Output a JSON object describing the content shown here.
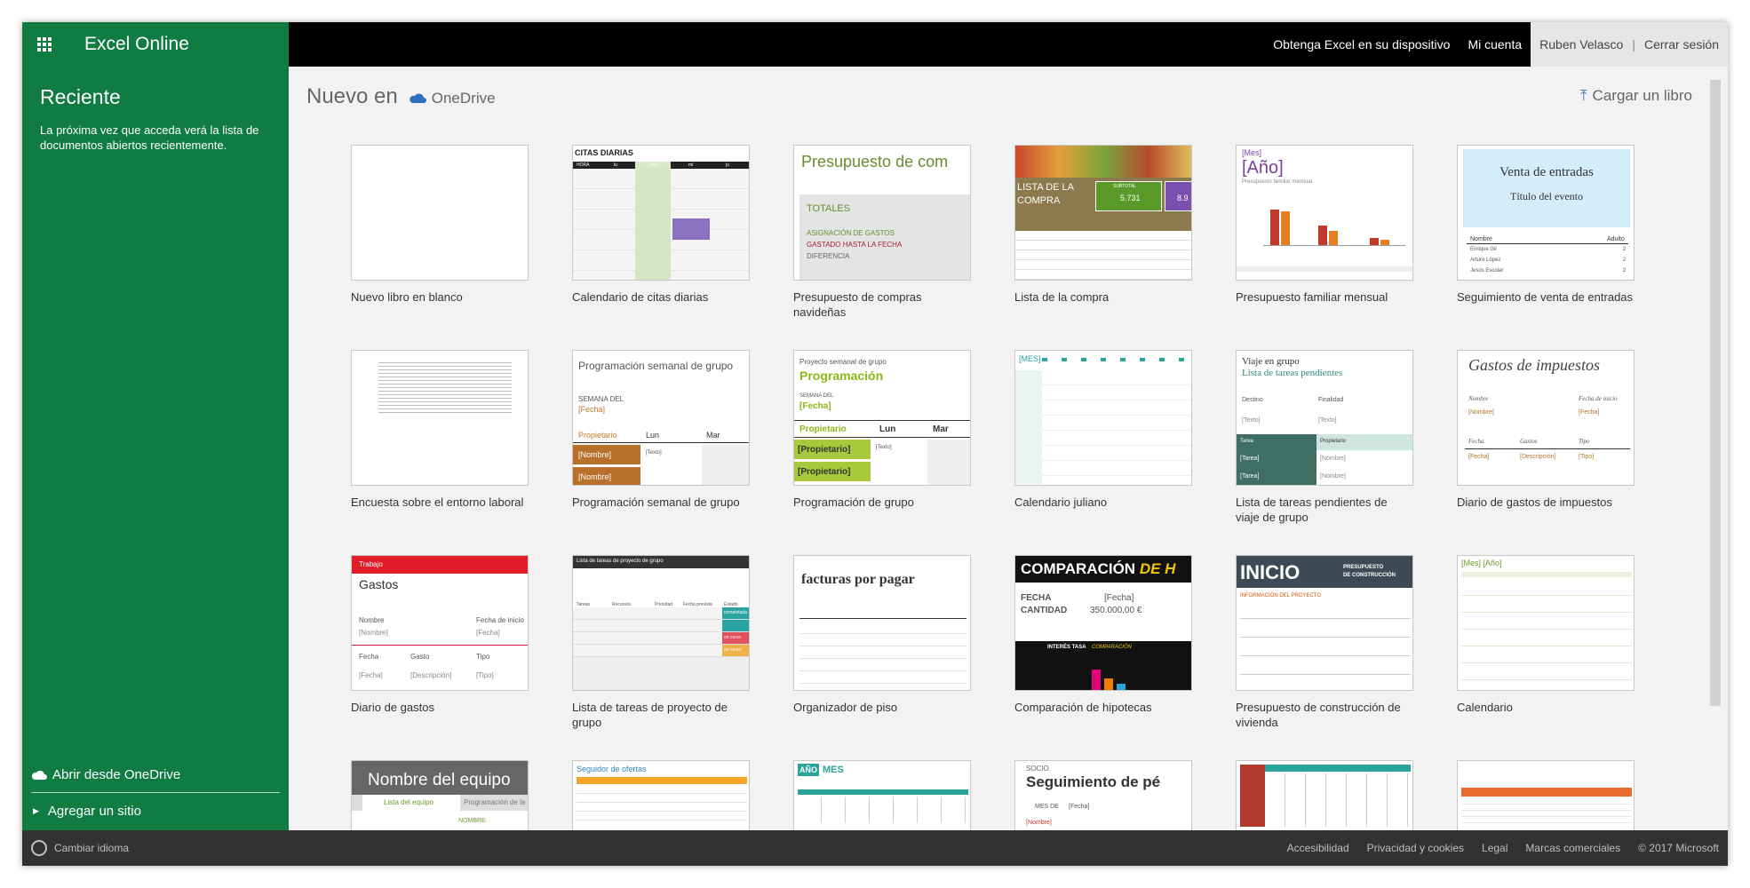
{
  "app": {
    "name": "Excel Online"
  },
  "sidebar": {
    "recent_title": "Reciente",
    "recent_text": "La próxima vez que acceda verá la lista de documentos abiertos recientemente.",
    "open_onedrive": "Abrir desde OneDrive",
    "add_site": "Agregar un sitio"
  },
  "topbar": {
    "get_excel": "Obtenga Excel en su dispositivo",
    "my_account": "Mi cuenta",
    "user": "Ruben Velasco",
    "sign_out": "Cerrar sesión"
  },
  "main": {
    "new_in": "Nuevo en",
    "onedrive": "OneDrive",
    "upload": "Cargar un libro"
  },
  "templates": [
    {
      "label": "Nuevo libro en blanco"
    },
    {
      "label": "Calendario de citas diarias"
    },
    {
      "label": "Presupuesto de compras navideñas"
    },
    {
      "label": "Lista de la compra"
    },
    {
      "label": "Presupuesto familiar mensual"
    },
    {
      "label": "Seguimiento de venta de entradas"
    },
    {
      "label": "Encuesta sobre el entorno laboral"
    },
    {
      "label": "Programación semanal de grupo"
    },
    {
      "label": "Programación de grupo"
    },
    {
      "label": "Calendario juliano"
    },
    {
      "label": "Lista de tareas pendientes de viaje de grupo"
    },
    {
      "label": "Diario de gastos de impuestos"
    },
    {
      "label": "Diario de gastos"
    },
    {
      "label": "Lista de tareas de proyecto de grupo"
    },
    {
      "label": "Organizador de piso"
    },
    {
      "label": "Comparación de hipotecas"
    },
    {
      "label": "Presupuesto de construcción de vivienda"
    },
    {
      "label": "Calendario"
    },
    {
      "label": ""
    },
    {
      "label": ""
    },
    {
      "label": ""
    },
    {
      "label": ""
    },
    {
      "label": ""
    },
    {
      "label": ""
    }
  ],
  "thumbs": {
    "citas": {
      "title": "CITAS DIARIAS",
      "cols": [
        "HORA",
        "lu",
        "ma",
        "mi",
        "ju"
      ]
    },
    "presupuesto": {
      "title": "Presupuesto de com",
      "totales": "TOTALES",
      "l1": "ASIGNACIÓN DE GASTOS",
      "l2": "GASTADO HASTA LA FECHA",
      "l3": "DIFERENCIA"
    },
    "compra": {
      "title": "LISTA DE LA COMPRA",
      "box1_label": "SUBTOTAL",
      "box1_value": "5.731",
      "box2_value": "8.9"
    },
    "familiar": {
      "mes": "[Mes]",
      "anio": "[Año]",
      "sub": "Presupuesto familiar mensual"
    },
    "entradas": {
      "title": "Venta de entradas",
      "sub": "Título del evento",
      "col1": "Nombre",
      "col2": "Adulto",
      "r1": "Enrique Gil",
      "r2": "Arturo López",
      "r3": "Jesús Escolar",
      "v": "2"
    },
    "semanal": {
      "title": "Programación semanal de grupo",
      "semana": "SEMANA DEL",
      "fecha": "[Fecha]",
      "prop": "Propietario",
      "lun": "Lun",
      "mar": "Mar",
      "nombre": "[Nombre]",
      "texto": "[Texto]"
    },
    "grupo": {
      "head": "Proyecto semanal de grupo",
      "title": "Programación",
      "semana": "SEMANA DEL",
      "fecha": "[Fecha]",
      "prop": "Propietario",
      "lun": "Lun",
      "mar": "Mar",
      "p": "[Propietario]",
      "texto": "[Texto]"
    },
    "juliano": {
      "mes": "[MES]"
    },
    "viaje": {
      "title": "Viaje en grupo",
      "sub": "Lista de tareas pendientes",
      "destino": "Destino",
      "finalidad": "Finalidad",
      "texto": "[Texto]",
      "tarea": "Tarea",
      "prop": "Propietario",
      "tareav": "[Tarea]",
      "nombre": "[Nombre]"
    },
    "impuestos": {
      "title": "Gastos de impuestos",
      "nombre": "Nombre",
      "fi": "Fecha de inicio",
      "nv": "[Nombre]",
      "fv": "[Fecha]",
      "f": "Fecha",
      "g": "Gastos",
      "t": "Tipo",
      "d": "[Descripción]",
      "tv": "[Tipo]"
    },
    "diario": {
      "trabajo": "Trabajo",
      "title": "Gastos",
      "nombre": "Nombre",
      "fi": "Fecha de inicio",
      "nv": "[Nombre]",
      "fv": "[Fecha]",
      "f": "Fecha",
      "g": "Gasto",
      "t": "Tipo",
      "d": "[Descripción]",
      "tv": "[Tipo]"
    },
    "tareas": {
      "title": "Lista de tareas de proyecto de grupo",
      "c1": "Tareas",
      "c2": "Recursos",
      "c3": "Prioridad",
      "c4": "Fecha prevista",
      "c5": "Estado",
      "s1": "completada",
      "s2": "en curso",
      "s3": "en curso"
    },
    "piso": {
      "title": "facturas por pagar"
    },
    "hipoteca": {
      "title": "COMPARACIÓN",
      "title2": "DE H",
      "fecha": "FECHA",
      "fv": "[Fecha]",
      "cant": "CANTIDAD",
      "cv": "350.000,00 €",
      "interes": "INTERÉS TASA",
      "comp": "COMPARACIÓN"
    },
    "construccion": {
      "inicio": "INICIO",
      "sub1": "PRESUPUESTO",
      "sub2": "DE CONSTRUCCIÓN",
      "info": "INFORMACIÓN DEL PROYECTO"
    },
    "calendario": {
      "title": "[Mes] [Año]"
    },
    "equipo": {
      "title": "Nombre del equipo",
      "tab1": "Lista del equipo",
      "tab2": "Programación de la",
      "nombre": "NOMBRE"
    },
    "ofertas": {
      "title": "Seguidor de ofertas"
    },
    "aniomes": {
      "anio": "AÑO",
      "mes": "MES"
    },
    "socio": {
      "socio": "SOCIO",
      "title": "Seguimiento de pé",
      "mes": "MES DE",
      "fecha": "[Fecha]",
      "nombre": "[Nombre]"
    }
  },
  "footer": {
    "language": "Cambiar idioma",
    "links": [
      "Accesibilidad",
      "Privacidad y cookies",
      "Legal",
      "Marcas comerciales",
      "© 2017 Microsoft"
    ]
  },
  "colors": {
    "excel_green": "#107c41",
    "topbar": "#000000",
    "footer": "#323232"
  }
}
